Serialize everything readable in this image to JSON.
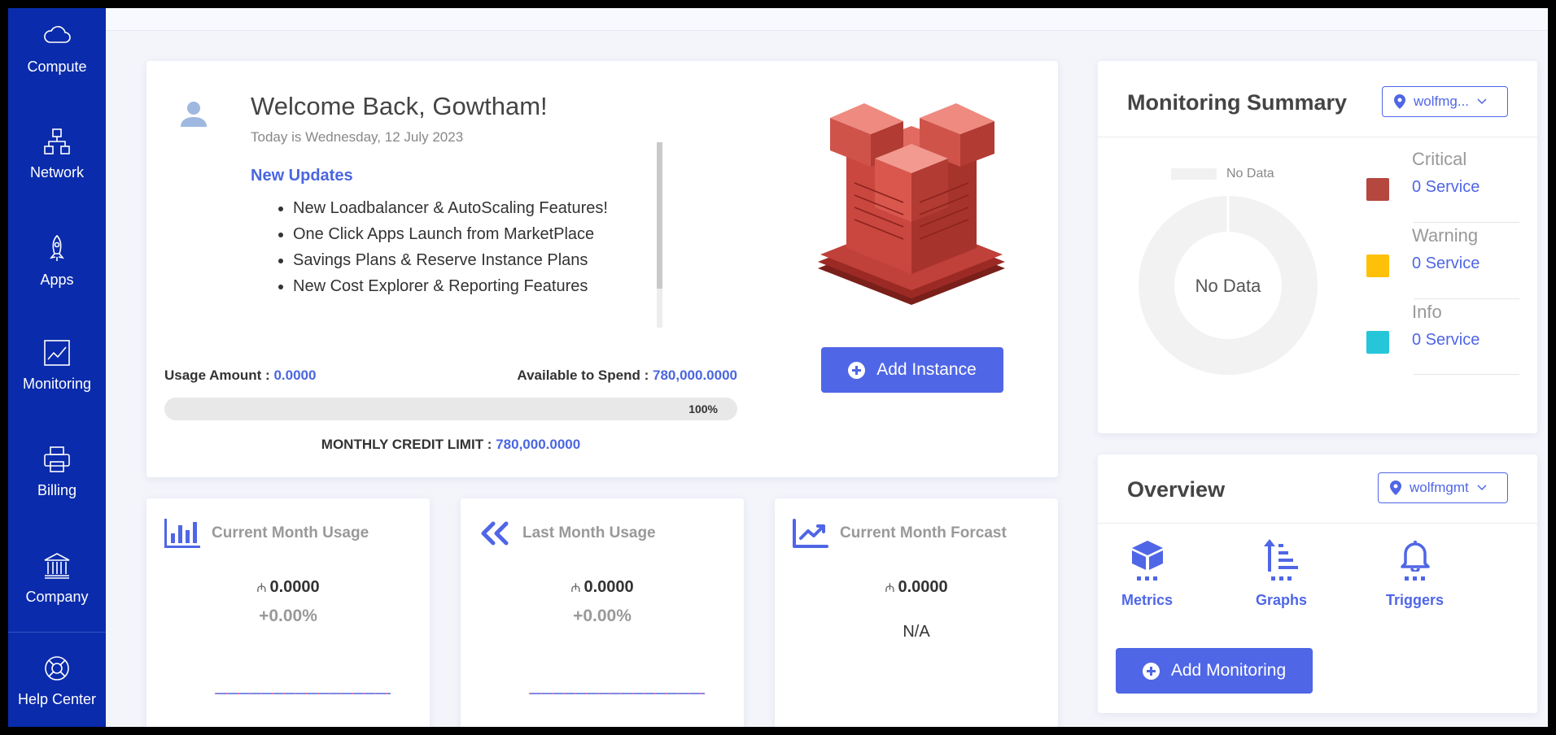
{
  "sidebar": {
    "items": [
      {
        "label": "Compute",
        "icon": "cloud-icon"
      },
      {
        "label": "Network",
        "icon": "network-icon"
      },
      {
        "label": "Apps",
        "icon": "rocket-icon"
      },
      {
        "label": "Monitoring",
        "icon": "chart-icon"
      },
      {
        "label": "Billing",
        "icon": "printer-icon"
      },
      {
        "label": "Company",
        "icon": "bank-icon"
      },
      {
        "label": "Help Center",
        "icon": "lifebuoy-icon"
      }
    ]
  },
  "welcome": {
    "title": "Welcome Back, Gowtham!",
    "date": "Today is Wednesday, 12 July 2023",
    "updates_title": "New Updates",
    "updates": [
      "New Loadbalancer & AutoScaling Features!",
      "One Click Apps Launch from MarketPlace",
      "Savings Plans & Reserve Instance Plans",
      "New Cost Explorer & Reporting Features"
    ],
    "usage_label": "Usage Amount :",
    "usage_value": "0.0000",
    "available_label": "Available to Spend :",
    "available_value": "780,000.0000",
    "progress_text": "100%",
    "progress_fraction": 1.0,
    "credit_label": "MONTHLY CREDIT LIMIT :",
    "credit_value": "780,000.0000",
    "add_instance_label": "Add Instance"
  },
  "cards": {
    "current_month": {
      "title": "Current Month Usage",
      "currency": "₼",
      "amount": "0.0000",
      "change": "+0.00%"
    },
    "last_month": {
      "title": "Last Month Usage",
      "currency": "₼",
      "amount": "0.0000",
      "change": "+0.00%"
    },
    "forecast": {
      "title": "Current Month Forcast",
      "currency": "₼",
      "amount": "0.0000",
      "note": "N/A"
    }
  },
  "monitoring_summary": {
    "title": "Monitoring Summary",
    "location": "wolfmg...",
    "legend_nodata": "No Data",
    "donut_center": "No Data",
    "statuses": [
      {
        "name": "Critical",
        "value": "0 Service",
        "color": "#b5473f"
      },
      {
        "name": "Warning",
        "value": "0 Service",
        "color": "#ffc107"
      },
      {
        "name": "Info",
        "value": "0 Service",
        "color": "#26c6da"
      }
    ]
  },
  "overview": {
    "title": "Overview",
    "location": "wolfmgmt",
    "items": [
      {
        "label": "Metrics",
        "icon": "cube-icon"
      },
      {
        "label": "Graphs",
        "icon": "sort-bars-icon"
      },
      {
        "label": "Triggers",
        "icon": "bell-icon"
      }
    ],
    "add_monitoring_label": "Add Monitoring"
  },
  "colors": {
    "sidebar": "#0a2bab",
    "accent": "#4f66e6"
  }
}
